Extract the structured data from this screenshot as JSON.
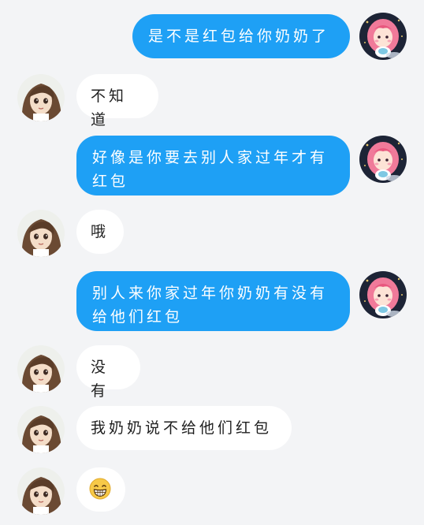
{
  "messages": [
    {
      "side": "me",
      "text": "是不是红包给你奶奶了"
    },
    {
      "side": "them",
      "text": "不知道"
    },
    {
      "side": "me",
      "text": "好像是你要去别人家过年才有红包"
    },
    {
      "side": "them",
      "text": "哦"
    },
    {
      "side": "me",
      "text": "别人来你家过年你奶奶有没有给他们红包"
    },
    {
      "side": "them",
      "text": "没有"
    },
    {
      "side": "them",
      "text": "我奶奶说不给他们红包"
    },
    {
      "side": "them",
      "emoji": "grinning-face-emoji"
    }
  ],
  "colors": {
    "background": "#f3f4f6",
    "my_bubble": "#1ea0f5",
    "their_bubble": "#ffffff"
  }
}
